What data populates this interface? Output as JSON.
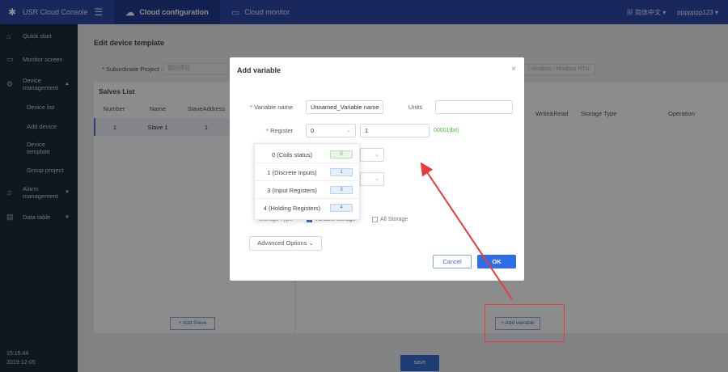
{
  "header": {
    "brand": "USR Cloud Console",
    "tabs": [
      {
        "label": "Cloud configuration",
        "icon": "cloud-icon",
        "active": true
      },
      {
        "label": "Cloud monitor",
        "icon": "monitor-icon",
        "active": false
      }
    ],
    "language": "简体中文",
    "user": "ppppppp123"
  },
  "sidebar": {
    "items": [
      {
        "label": "Quick start",
        "icon": "home-icon"
      },
      {
        "label": "Monitor screen",
        "icon": "screen-icon"
      },
      {
        "label": "Device management",
        "icon": "gear-icon",
        "expanded": true
      },
      {
        "label": "Alarm management",
        "icon": "bell-icon"
      },
      {
        "label": "Data table",
        "icon": "table-icon"
      }
    ],
    "device_sub": [
      "Device list",
      "Add device",
      "Device template",
      "Group project"
    ],
    "time": "15:15:44",
    "date": "2019-12-05"
  },
  "main": {
    "title": "Edit device template",
    "subordinate_label": "* Subordinate Project :",
    "subordinate_value": "我的项目",
    "crumbs": "/ Modbus / Modbus RTU",
    "slaves": {
      "title": "Salves List",
      "columns": [
        "Number",
        "Name",
        "SlaveAddress"
      ],
      "rows": [
        {
          "number": "1",
          "name": "Slave 1",
          "address": "1"
        }
      ],
      "add_label": "+ Add Slave"
    },
    "variables": {
      "columns": [
        "Write&Read",
        "Storage Type",
        "Operation"
      ],
      "add_label": "+ Add variable"
    },
    "save_label": "save"
  },
  "modal": {
    "title": "Add variable",
    "variable_name_label": "Variable name",
    "variable_name_value": "Unnamed_Variable name",
    "units_label": "Units",
    "units_value": "",
    "register_label": "Register",
    "register_select": "0",
    "register_address": "1",
    "register_hint": "00001(bit)",
    "storage_label": "Storage Type",
    "storage_option_label": "Variable storage",
    "all_storage_label": "All Storage",
    "advanced_label": "Advanced Options",
    "cancel_label": "Cancel",
    "ok_label": "OK"
  },
  "register_options": [
    {
      "label": "0 (Coils status)",
      "tag": "0",
      "color": "green"
    },
    {
      "label": "1 (Discrete Inputs)",
      "tag": "1",
      "color": "blue"
    },
    {
      "label": "3 (Input Registers)",
      "tag": "3",
      "color": "blue"
    },
    {
      "label": "4 (Holding Registers)",
      "tag": "4",
      "color": "blue"
    }
  ],
  "colors": {
    "accent": "#2f6ee8",
    "header": "#2d4aa8",
    "sidebar": "#1d2a3c",
    "annotation": "#e83b3b",
    "register_hint": "#4cbb3a"
  }
}
